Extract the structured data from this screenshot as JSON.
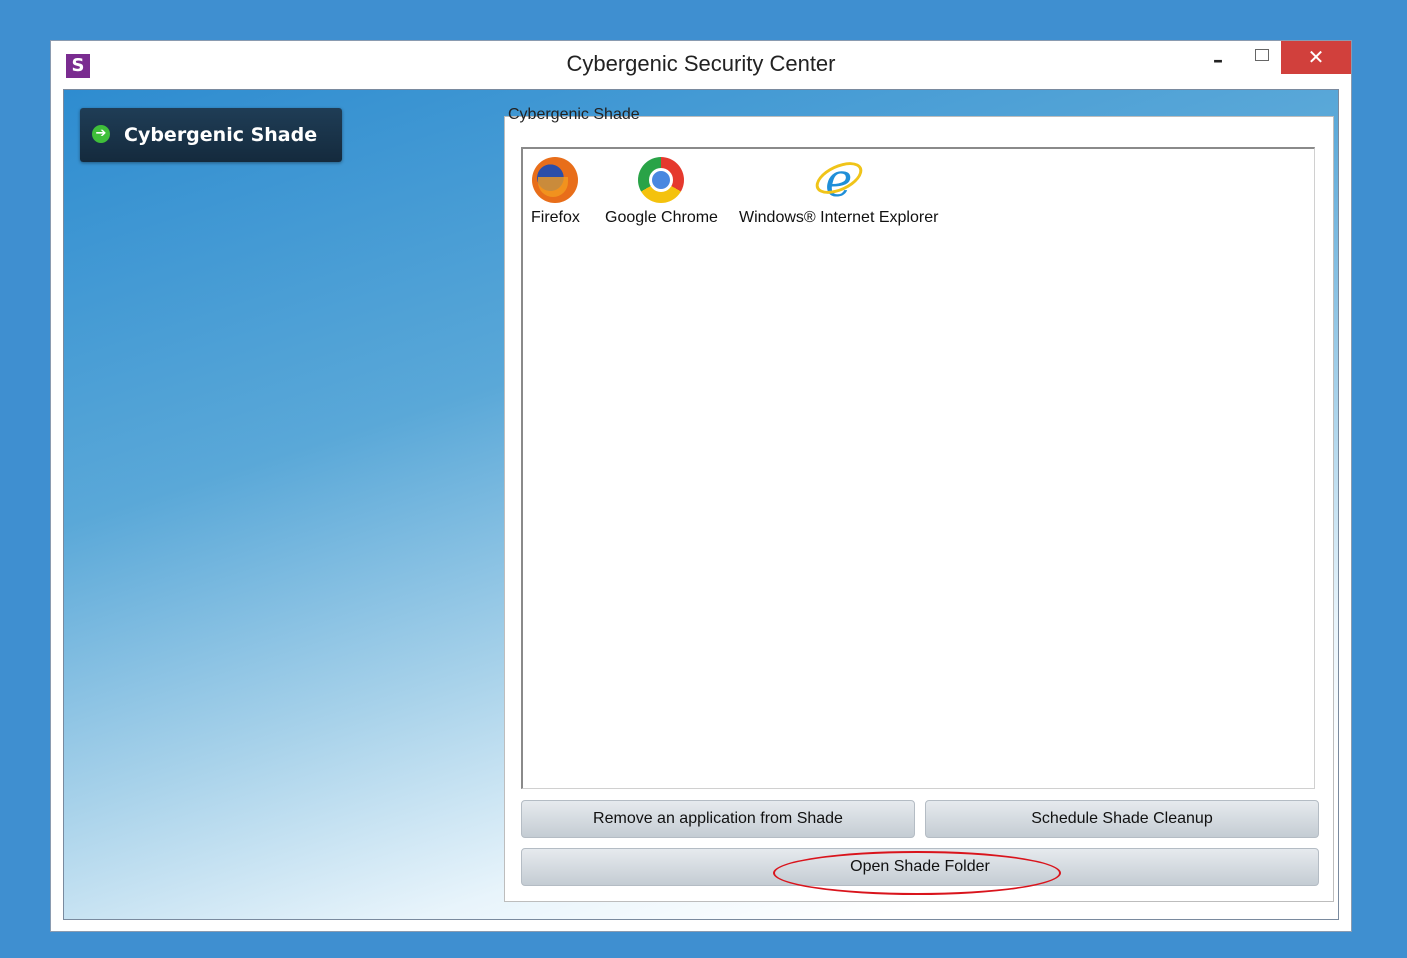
{
  "window": {
    "title": "Cybergenic Security Center",
    "app_icon_letter": "S",
    "minimize_glyph": "–",
    "close_glyph": "✕"
  },
  "sidebar": {
    "items": [
      {
        "label": "Cybergenic Shade",
        "icon": "arrow-right-circle-icon",
        "selected": true
      }
    ]
  },
  "shade_panel": {
    "legend": "Cybergenic Shade",
    "applications": [
      {
        "label": "Firefox",
        "icon": "firefox-icon"
      },
      {
        "label": "Google Chrome",
        "icon": "chrome-icon"
      },
      {
        "label": "Windows® Internet Explorer",
        "icon": "internet-explorer-icon"
      }
    ],
    "buttons": {
      "remove": "Remove an application from Shade",
      "schedule": "Schedule Shade Cleanup",
      "open_folder": "Open Shade Folder"
    }
  },
  "colors": {
    "desktop": "#3f8fd0",
    "close_button": "#d1403c",
    "app_icon_bg": "#7a2c90",
    "nav_button": "#1f3d56",
    "annotation": "#d9141c"
  }
}
